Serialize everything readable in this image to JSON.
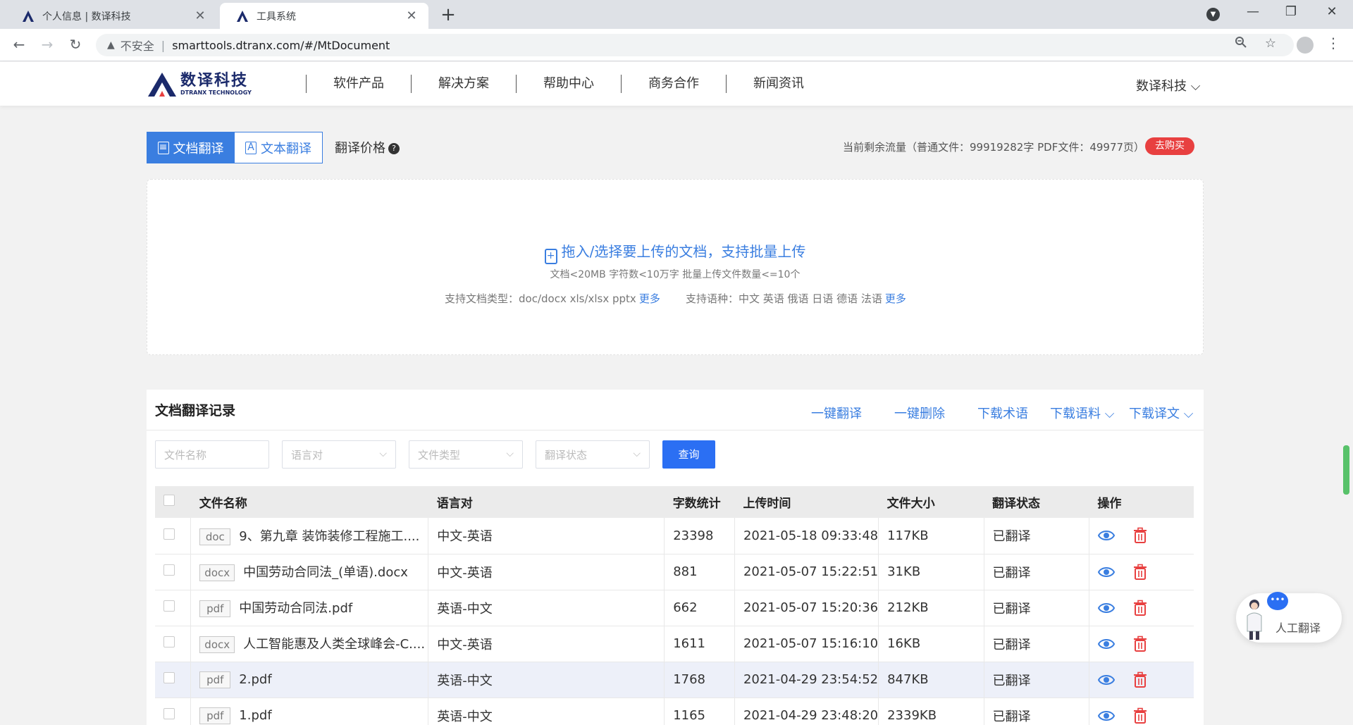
{
  "browser": {
    "tabs": [
      {
        "title": "个人信息 | 数译科技"
      },
      {
        "title": "工具系统"
      }
    ],
    "omnibox": {
      "security_text": "不安全",
      "url": "smarttools.dtranx.com/#/MtDocument"
    }
  },
  "site": {
    "logo": {
      "cn": "数译科技",
      "en": "DTRANX TECHNOLOGY"
    },
    "nav": [
      "软件产品",
      "解决方案",
      "帮助中心",
      "商务合作",
      "新闻资讯"
    ],
    "user_menu": "数译科技 ⌵"
  },
  "modes": {
    "doc": "文档翻译",
    "text": "文本翻译",
    "price": "翻译价格"
  },
  "quota": {
    "text": "当前剩余流量（普通文件：99919282字 PDF文件：49977页）",
    "buy": "去购买"
  },
  "upload": {
    "main": "拖入/选择要上传的文档，支持批量上传",
    "limits": "文档<20MB 字符数<10万字 批量上传文件数量<=10个",
    "types": "支持文档类型：doc/docx xls/xlsx pptx",
    "langs": "支持语种：中文 英语 俄语 日语 德语 法语",
    "more": "更多"
  },
  "records": {
    "title": "文档翻译记录",
    "actions": [
      "一键翻译",
      "一键删除",
      "下载术语",
      "下载语料 ⌵",
      "下载译文 ⌵"
    ],
    "filters": {
      "name_placeholder": "文件名称",
      "lang_placeholder": "语言对",
      "type_placeholder": "文件类型",
      "status_placeholder": "翻译状态",
      "query": "查询"
    },
    "columns": [
      "文件名称",
      "语言对",
      "字数统计",
      "上传时间",
      "文件大小",
      "翻译状态",
      "操作"
    ],
    "rows": [
      {
        "type": "doc",
        "name": "9、第九章 装饰装修工程施工....",
        "lang": "中文-英语",
        "words": "23398",
        "time": "2021-05-18 09:33:48",
        "size": "117KB",
        "status": "已翻译"
      },
      {
        "type": "docx",
        "name": "中国劳动合同法_(单语).docx",
        "lang": "中文-英语",
        "words": "881",
        "time": "2021-05-07 15:22:51",
        "size": "31KB",
        "status": "已翻译"
      },
      {
        "type": "pdf",
        "name": "中国劳动合同法.pdf",
        "lang": "英语-中文",
        "words": "662",
        "time": "2021-05-07 15:20:36",
        "size": "212KB",
        "status": "已翻译"
      },
      {
        "type": "docx",
        "name": "人工智能惠及人类全球峰会-C....",
        "lang": "中文-英语",
        "words": "1611",
        "time": "2021-05-07 15:16:10",
        "size": "16KB",
        "status": "已翻译"
      },
      {
        "type": "pdf",
        "name": "2.pdf",
        "lang": "英语-中文",
        "words": "1768",
        "time": "2021-04-29 23:54:52",
        "size": "847KB",
        "status": "已翻译"
      },
      {
        "type": "pdf",
        "name": "1.pdf",
        "lang": "英语-中文",
        "words": "1165",
        "time": "2021-04-29 23:48:20",
        "size": "2339KB",
        "status": "已翻译"
      }
    ]
  },
  "widget": {
    "label": "人工翻译"
  },
  "colors": {
    "accent": "#3a7ee0",
    "query_btn": "#2b6ff3",
    "buy": "#e84040",
    "delete_icon": "#e84040",
    "brand": "#1b2a6b"
  }
}
